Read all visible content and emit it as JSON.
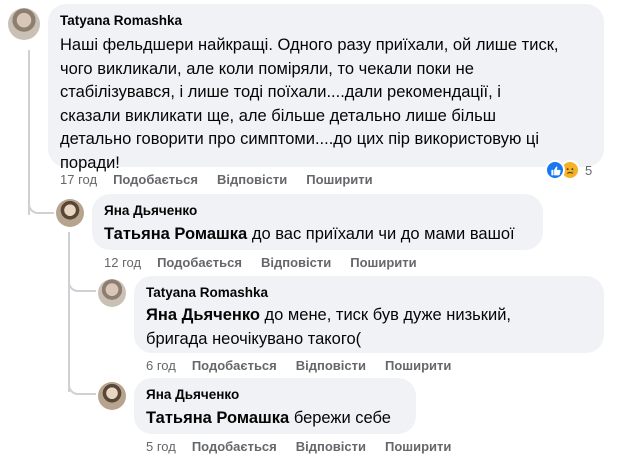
{
  "comments": [
    {
      "author": "Tatyana Romashka",
      "lines": [
        "Наші фельдшери найкращі. Одного разу приїхали, ой лише тиск,",
        "чого викликали, але коли поміряли, то чекали поки не",
        "стабілізувався, і лише тоді поїхали....дали рекомендації, і",
        "сказали викликати ще, але більше детально лише більш",
        "детально говорити про симптоми....до цих пір використовую ці",
        "поради!"
      ],
      "time": "17 год",
      "like_label": "Подобається",
      "reply_label": "Відповісти",
      "share_label": "Поширити",
      "reaction_count": "5",
      "reaction_icons": [
        "like-icon",
        "sad-icon"
      ]
    },
    {
      "author": "Яна Дьяченко",
      "mention": "Татьяна Ромашка",
      "text": " до вас приїхали чи до мами вашої",
      "time": "12 год",
      "like_label": "Подобається",
      "reply_label": "Відповісти",
      "share_label": "Поширити"
    },
    {
      "author": "Tatyana Romashka",
      "mention": "Яна Дьяченко",
      "text": " до мене, тиск був дуже низький,",
      "text_line2": "бригада неочікувано такого(",
      "time": "6 год",
      "like_label": "Подобається",
      "reply_label": "Відповісти",
      "share_label": "Поширити"
    },
    {
      "author": "Яна Дьяченко",
      "mention": "Татьяна Ромашка",
      "text": " бережи себе",
      "time": "5 год",
      "like_label": "Подобається",
      "reply_label": "Відповісти",
      "share_label": "Поширити"
    }
  ],
  "colors": {
    "bubble_bg": "#f0f2f5",
    "meta_text": "#65676b",
    "like_blue": "#1877f2",
    "sad_yellow": "#f7b125",
    "thread_line": "#ced0d4"
  }
}
